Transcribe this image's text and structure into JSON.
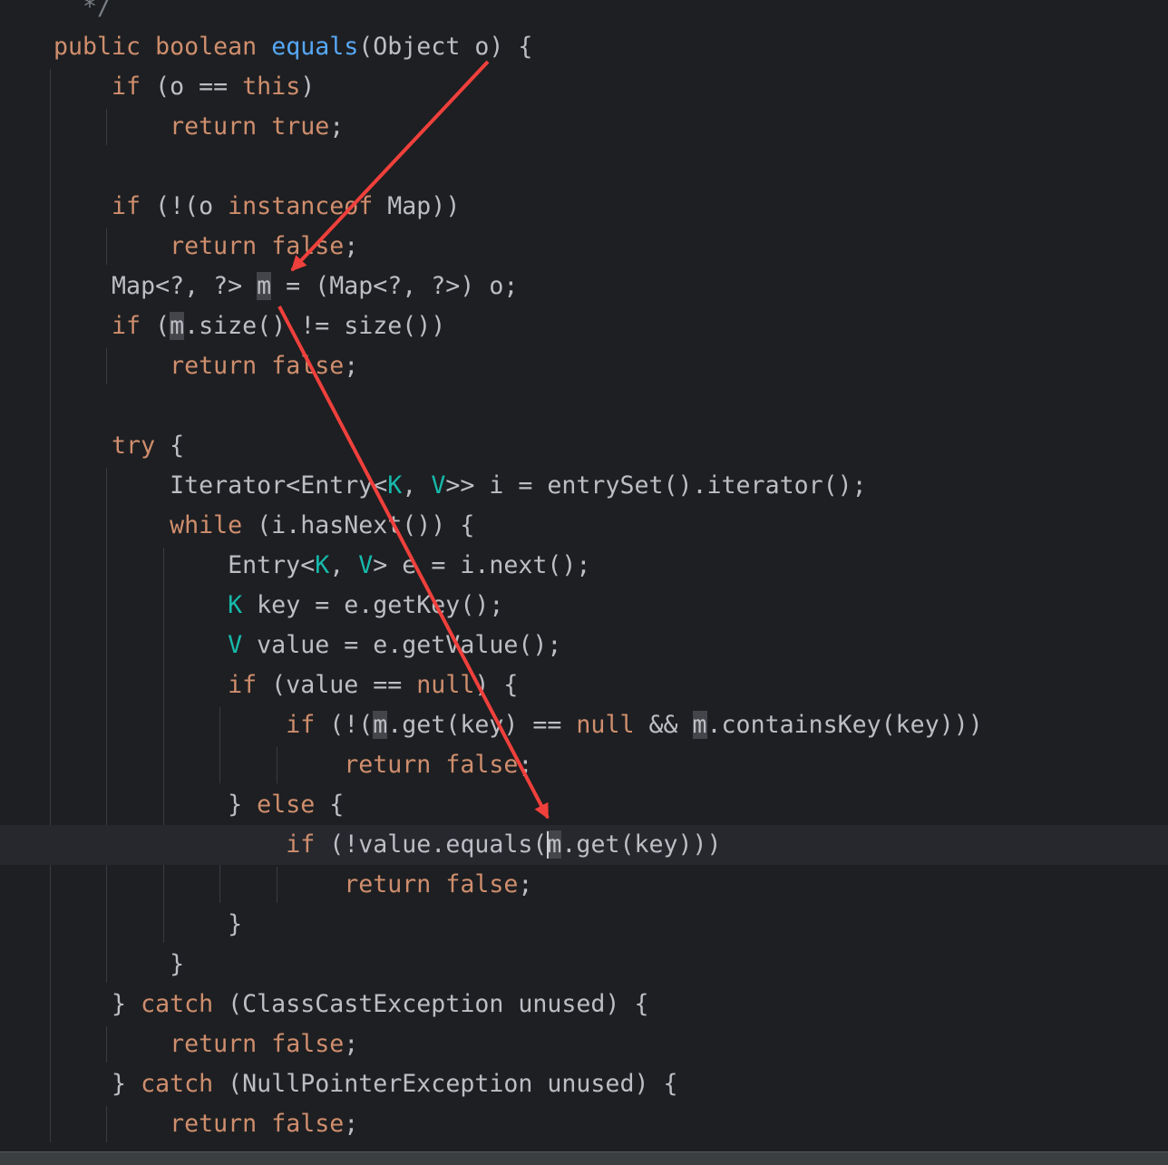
{
  "editor": {
    "language": "java",
    "caret_line": 21,
    "colors": {
      "background": "#1e1f22",
      "current_line": "#26282e",
      "keyword": "#cf8e6d",
      "method_declaration": "#56a8f5",
      "type_parameter": "#16baac",
      "comment": "#7a7e85",
      "plain_text": "#bcbec4",
      "usage_highlight": "#43454a",
      "annotation_arrow": "#f0403c"
    },
    "lines": [
      {
        "indent": "  ",
        "tokens": [
          {
            "t": "*/",
            "c": "cm"
          }
        ]
      },
      {
        "indent": "",
        "tokens": [
          {
            "t": "public",
            "c": "kw"
          },
          {
            "t": " "
          },
          {
            "t": "boolean",
            "c": "kw"
          },
          {
            "t": " "
          },
          {
            "t": "equals",
            "c": "fn"
          },
          {
            "t": "(Object o) {"
          }
        ]
      },
      {
        "indent": "    ",
        "tokens": [
          {
            "t": "if",
            "c": "kw"
          },
          {
            "t": " (o == "
          },
          {
            "t": "this",
            "c": "kw"
          },
          {
            "t": ")"
          }
        ]
      },
      {
        "indent": "        ",
        "tokens": [
          {
            "t": "return",
            "c": "kw"
          },
          {
            "t": " "
          },
          {
            "t": "true",
            "c": "kw"
          },
          {
            "t": ";"
          }
        ]
      },
      {
        "indent": "",
        "tokens": []
      },
      {
        "indent": "    ",
        "tokens": [
          {
            "t": "if",
            "c": "kw"
          },
          {
            "t": " (!(o "
          },
          {
            "t": "instanceof",
            "c": "kw"
          },
          {
            "t": " Map))"
          }
        ]
      },
      {
        "indent": "        ",
        "tokens": [
          {
            "t": "return",
            "c": "kw"
          },
          {
            "t": " "
          },
          {
            "t": "false",
            "c": "kw"
          },
          {
            "t": ";"
          }
        ]
      },
      {
        "indent": "    ",
        "tokens": [
          {
            "t": "Map<?, ?> "
          },
          {
            "t": "m",
            "h": true
          },
          {
            "t": " = (Map<?, ?>) o;"
          }
        ]
      },
      {
        "indent": "    ",
        "tokens": [
          {
            "t": "if",
            "c": "kw"
          },
          {
            "t": " ("
          },
          {
            "t": "m",
            "h": true
          },
          {
            "t": ".size() != size())"
          }
        ]
      },
      {
        "indent": "        ",
        "tokens": [
          {
            "t": "return",
            "c": "kw"
          },
          {
            "t": " "
          },
          {
            "t": "false",
            "c": "kw"
          },
          {
            "t": ";"
          }
        ]
      },
      {
        "indent": "",
        "tokens": []
      },
      {
        "indent": "    ",
        "tokens": [
          {
            "t": "try",
            "c": "kw"
          },
          {
            "t": " {"
          }
        ]
      },
      {
        "indent": "        ",
        "tokens": [
          {
            "t": "Iterator<Entry<"
          },
          {
            "t": "K",
            "c": "tp"
          },
          {
            "t": ", "
          },
          {
            "t": "V",
            "c": "tp"
          },
          {
            "t": ">> i = entrySet().iterator();"
          }
        ]
      },
      {
        "indent": "        ",
        "tokens": [
          {
            "t": "while",
            "c": "kw"
          },
          {
            "t": " (i.hasNext()) {"
          }
        ]
      },
      {
        "indent": "            ",
        "tokens": [
          {
            "t": "Entry<"
          },
          {
            "t": "K",
            "c": "tp"
          },
          {
            "t": ", "
          },
          {
            "t": "V",
            "c": "tp"
          },
          {
            "t": "> e = i.next();"
          }
        ]
      },
      {
        "indent": "            ",
        "tokens": [
          {
            "t": "K",
            "c": "tp"
          },
          {
            "t": " key = e.getKey();"
          }
        ]
      },
      {
        "indent": "            ",
        "tokens": [
          {
            "t": "V",
            "c": "tp"
          },
          {
            "t": " value = e.getValue();"
          }
        ]
      },
      {
        "indent": "            ",
        "tokens": [
          {
            "t": "if",
            "c": "kw"
          },
          {
            "t": " (value == "
          },
          {
            "t": "null",
            "c": "kw"
          },
          {
            "t": ") {"
          }
        ]
      },
      {
        "indent": "                ",
        "tokens": [
          {
            "t": "if",
            "c": "kw"
          },
          {
            "t": " (!("
          },
          {
            "t": "m",
            "h": true
          },
          {
            "t": ".get(key) == "
          },
          {
            "t": "null",
            "c": "kw"
          },
          {
            "t": " && "
          },
          {
            "t": "m",
            "h": true
          },
          {
            "t": ".containsKey(key)))"
          }
        ]
      },
      {
        "indent": "                    ",
        "tokens": [
          {
            "t": "return",
            "c": "kw"
          },
          {
            "t": " "
          },
          {
            "t": "false",
            "c": "kw"
          },
          {
            "t": ";"
          }
        ]
      },
      {
        "indent": "            ",
        "tokens": [
          {
            "t": "} "
          },
          {
            "t": "else",
            "c": "kw"
          },
          {
            "t": " {"
          }
        ]
      },
      {
        "indent": "                ",
        "tokens": [
          {
            "t": "if",
            "c": "kw"
          },
          {
            "t": " (!value.equals("
          },
          {
            "t": "m",
            "h": true
          },
          {
            "t": ".get(key)))"
          }
        ]
      },
      {
        "indent": "                    ",
        "tokens": [
          {
            "t": "return",
            "c": "kw"
          },
          {
            "t": " "
          },
          {
            "t": "false",
            "c": "kw"
          },
          {
            "t": ";"
          }
        ]
      },
      {
        "indent": "            ",
        "tokens": [
          {
            "t": "}"
          }
        ]
      },
      {
        "indent": "        ",
        "tokens": [
          {
            "t": "}"
          }
        ]
      },
      {
        "indent": "    ",
        "tokens": [
          {
            "t": "} "
          },
          {
            "t": "catch",
            "c": "kw"
          },
          {
            "t": " (ClassCastException unused) {"
          }
        ]
      },
      {
        "indent": "        ",
        "tokens": [
          {
            "t": "return",
            "c": "kw"
          },
          {
            "t": " "
          },
          {
            "t": "false",
            "c": "kw"
          },
          {
            "t": ";"
          }
        ]
      },
      {
        "indent": "    ",
        "tokens": [
          {
            "t": "} "
          },
          {
            "t": "catch",
            "c": "kw"
          },
          {
            "t": " (NullPointerException unused) {"
          }
        ]
      },
      {
        "indent": "        ",
        "tokens": [
          {
            "t": "return",
            "c": "kw"
          },
          {
            "t": " "
          },
          {
            "t": "false",
            "c": "kw"
          },
          {
            "t": ";"
          }
        ]
      }
    ]
  }
}
